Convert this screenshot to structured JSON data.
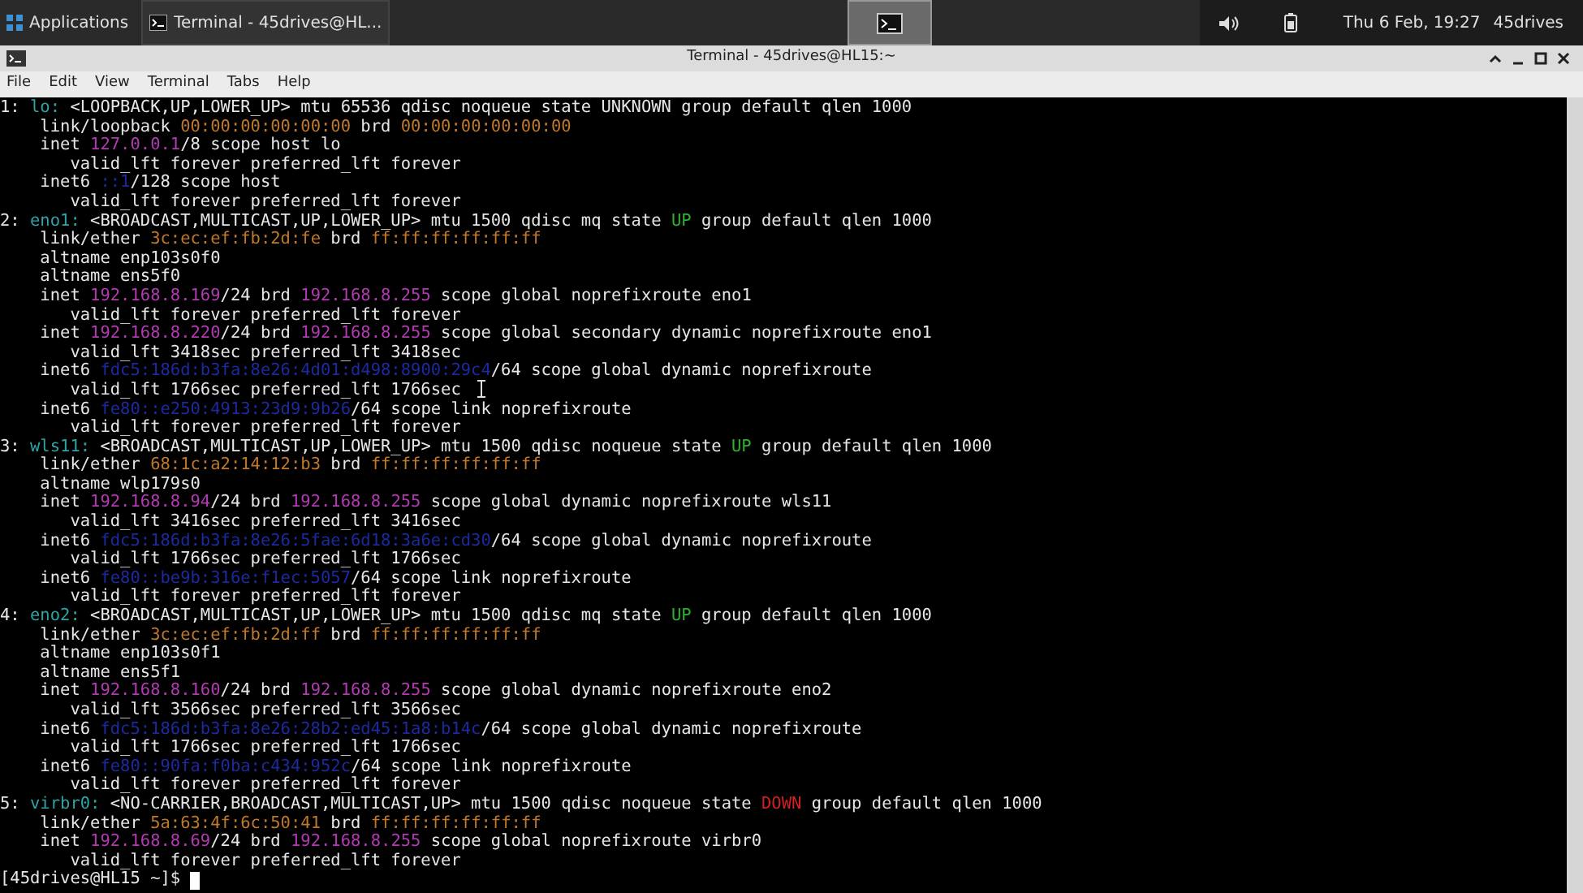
{
  "panel": {
    "apps_menu": "Applications",
    "tasks": [
      {
        "label": "Terminal - 45drives@HL...",
        "selected": false
      }
    ],
    "workspaces": [
      {
        "selected": true
      }
    ],
    "clock": "Thu 6 Feb, 19:27",
    "user": "45drives"
  },
  "window": {
    "title": "Terminal - 45drives@HL15:~"
  },
  "menu": [
    "File",
    "Edit",
    "View",
    "Terminal",
    "Tabs",
    "Help"
  ],
  "terminal": {
    "cursor_visible": true,
    "lines": [
      {
        "segments": [
          {
            "text": "1: ",
            "kind": "plain"
          },
          {
            "text": "lo:",
            "kind": "iface"
          },
          {
            "text": " <LOOPBACK,UP,LOWER_UP> mtu 65536 qdisc noqueue state UNKNOWN group default qlen 1000",
            "kind": "plain"
          }
        ]
      },
      {
        "segments": [
          {
            "text": "    link/loopback ",
            "kind": "plain"
          },
          {
            "text": "00:00:00:00:00:00",
            "kind": "mac"
          },
          {
            "text": " brd ",
            "kind": "plain"
          },
          {
            "text": "00:00:00:00:00:00",
            "kind": "mac"
          }
        ]
      },
      {
        "segments": [
          {
            "text": "    inet ",
            "kind": "plain"
          },
          {
            "text": "127.0.0.1",
            "kind": "ipv4"
          },
          {
            "text": "/8 scope host lo",
            "kind": "plain"
          }
        ]
      },
      {
        "segments": [
          {
            "text": "       valid_lft forever preferred_lft forever",
            "kind": "plain"
          }
        ]
      },
      {
        "segments": [
          {
            "text": "    inet6 ",
            "kind": "plain"
          },
          {
            "text": "::1",
            "kind": "ipv6"
          },
          {
            "text": "/128 scope host",
            "kind": "plain"
          }
        ]
      },
      {
        "segments": [
          {
            "text": "       valid_lft forever preferred_lft forever",
            "kind": "plain"
          }
        ]
      },
      {
        "segments": [
          {
            "text": "2: ",
            "kind": "plain"
          },
          {
            "text": "eno1:",
            "kind": "iface"
          },
          {
            "text": " <BROADCAST,MULTICAST,UP,LOWER_UP> mtu 1500 qdisc mq state ",
            "kind": "plain"
          },
          {
            "text": "UP",
            "kind": "up"
          },
          {
            "text": " group default qlen 1000",
            "kind": "plain"
          }
        ]
      },
      {
        "segments": [
          {
            "text": "    link/ether ",
            "kind": "plain"
          },
          {
            "text": "3c:ec:ef:fb:2d:fe",
            "kind": "mac"
          },
          {
            "text": " brd ",
            "kind": "plain"
          },
          {
            "text": "ff:ff:ff:ff:ff:ff",
            "kind": "mac"
          }
        ]
      },
      {
        "segments": [
          {
            "text": "    altname enp103s0f0",
            "kind": "plain"
          }
        ]
      },
      {
        "segments": [
          {
            "text": "    altname ens5f0",
            "kind": "plain"
          }
        ]
      },
      {
        "segments": [
          {
            "text": "    inet ",
            "kind": "plain"
          },
          {
            "text": "192.168.8.169",
            "kind": "ipv4"
          },
          {
            "text": "/24 brd ",
            "kind": "plain"
          },
          {
            "text": "192.168.8.255",
            "kind": "ipv4"
          },
          {
            "text": " scope global noprefixroute eno1",
            "kind": "plain"
          }
        ]
      },
      {
        "segments": [
          {
            "text": "       valid_lft forever preferred_lft forever",
            "kind": "plain"
          }
        ]
      },
      {
        "segments": [
          {
            "text": "    inet ",
            "kind": "plain"
          },
          {
            "text": "192.168.8.220",
            "kind": "ipv4"
          },
          {
            "text": "/24 brd ",
            "kind": "plain"
          },
          {
            "text": "192.168.8.255",
            "kind": "ipv4"
          },
          {
            "text": " scope global secondary dynamic noprefixroute eno1",
            "kind": "plain"
          }
        ]
      },
      {
        "segments": [
          {
            "text": "       valid_lft 3418sec preferred_lft 3418sec",
            "kind": "plain"
          }
        ]
      },
      {
        "segments": [
          {
            "text": "    inet6 ",
            "kind": "plain"
          },
          {
            "text": "fdc5:186d:b3fa:8e26:4d01:d498:8900:29c4",
            "kind": "ipv6"
          },
          {
            "text": "/64 scope global dynamic noprefixroute",
            "kind": "plain"
          }
        ]
      },
      {
        "segments": [
          {
            "text": "       valid_lft 1766sec preferred_lft 1766sec",
            "kind": "plain"
          }
        ]
      },
      {
        "segments": [
          {
            "text": "    inet6 ",
            "kind": "plain"
          },
          {
            "text": "fe80::e250:4913:23d9:9b26",
            "kind": "ipv6"
          },
          {
            "text": "/64 scope link noprefixroute",
            "kind": "plain"
          }
        ]
      },
      {
        "segments": [
          {
            "text": "       valid_lft forever preferred_lft forever",
            "kind": "plain"
          }
        ]
      },
      {
        "segments": [
          {
            "text": "3: ",
            "kind": "plain"
          },
          {
            "text": "wls11:",
            "kind": "iface"
          },
          {
            "text": " <BROADCAST,MULTICAST,UP,LOWER_UP> mtu 1500 qdisc noqueue state ",
            "kind": "plain"
          },
          {
            "text": "UP",
            "kind": "up"
          },
          {
            "text": " group default qlen 1000",
            "kind": "plain"
          }
        ]
      },
      {
        "segments": [
          {
            "text": "    link/ether ",
            "kind": "plain"
          },
          {
            "text": "68:1c:a2:14:12:b3",
            "kind": "mac"
          },
          {
            "text": " brd ",
            "kind": "plain"
          },
          {
            "text": "ff:ff:ff:ff:ff:ff",
            "kind": "mac"
          }
        ]
      },
      {
        "segments": [
          {
            "text": "    altname wlp179s0",
            "kind": "plain"
          }
        ]
      },
      {
        "segments": [
          {
            "text": "    inet ",
            "kind": "plain"
          },
          {
            "text": "192.168.8.94",
            "kind": "ipv4"
          },
          {
            "text": "/24 brd ",
            "kind": "plain"
          },
          {
            "text": "192.168.8.255",
            "kind": "ipv4"
          },
          {
            "text": " scope global dynamic noprefixroute wls11",
            "kind": "plain"
          }
        ]
      },
      {
        "segments": [
          {
            "text": "       valid_lft 3416sec preferred_lft 3416sec",
            "kind": "plain"
          }
        ]
      },
      {
        "segments": [
          {
            "text": "    inet6 ",
            "kind": "plain"
          },
          {
            "text": "fdc5:186d:b3fa:8e26:5fae:6d18:3a6e:cd30",
            "kind": "ipv6"
          },
          {
            "text": "/64 scope global dynamic noprefixroute",
            "kind": "plain"
          }
        ]
      },
      {
        "segments": [
          {
            "text": "       valid_lft 1766sec preferred_lft 1766sec",
            "kind": "plain"
          }
        ]
      },
      {
        "segments": [
          {
            "text": "    inet6 ",
            "kind": "plain"
          },
          {
            "text": "fe80::be9b:316e:f1ec:5057",
            "kind": "ipv6"
          },
          {
            "text": "/64 scope link noprefixroute",
            "kind": "plain"
          }
        ]
      },
      {
        "segments": [
          {
            "text": "       valid_lft forever preferred_lft forever",
            "kind": "plain"
          }
        ]
      },
      {
        "segments": [
          {
            "text": "4: ",
            "kind": "plain"
          },
          {
            "text": "eno2:",
            "kind": "iface"
          },
          {
            "text": " <BROADCAST,MULTICAST,UP,LOWER_UP> mtu 1500 qdisc mq state ",
            "kind": "plain"
          },
          {
            "text": "UP",
            "kind": "up"
          },
          {
            "text": " group default qlen 1000",
            "kind": "plain"
          }
        ]
      },
      {
        "segments": [
          {
            "text": "    link/ether ",
            "kind": "plain"
          },
          {
            "text": "3c:ec:ef:fb:2d:ff",
            "kind": "mac"
          },
          {
            "text": " brd ",
            "kind": "plain"
          },
          {
            "text": "ff:ff:ff:ff:ff:ff",
            "kind": "mac"
          }
        ]
      },
      {
        "segments": [
          {
            "text": "    altname enp103s0f1",
            "kind": "plain"
          }
        ]
      },
      {
        "segments": [
          {
            "text": "    altname ens5f1",
            "kind": "plain"
          }
        ]
      },
      {
        "segments": [
          {
            "text": "    inet ",
            "kind": "plain"
          },
          {
            "text": "192.168.8.160",
            "kind": "ipv4"
          },
          {
            "text": "/24 brd ",
            "kind": "plain"
          },
          {
            "text": "192.168.8.255",
            "kind": "ipv4"
          },
          {
            "text": " scope global dynamic noprefixroute eno2",
            "kind": "plain"
          }
        ]
      },
      {
        "segments": [
          {
            "text": "       valid_lft 3566sec preferred_lft 3566sec",
            "kind": "plain"
          }
        ]
      },
      {
        "segments": [
          {
            "text": "    inet6 ",
            "kind": "plain"
          },
          {
            "text": "fdc5:186d:b3fa:8e26:28b2:ed45:1a8:b14c",
            "kind": "ipv6"
          },
          {
            "text": "/64 scope global dynamic noprefixroute",
            "kind": "plain"
          }
        ]
      },
      {
        "segments": [
          {
            "text": "       valid_lft 1766sec preferred_lft 1766sec",
            "kind": "plain"
          }
        ]
      },
      {
        "segments": [
          {
            "text": "    inet6 ",
            "kind": "plain"
          },
          {
            "text": "fe80::90fa:f0ba:c434:952c",
            "kind": "ipv6"
          },
          {
            "text": "/64 scope link noprefixroute",
            "kind": "plain"
          }
        ]
      },
      {
        "segments": [
          {
            "text": "       valid_lft forever preferred_lft forever",
            "kind": "plain"
          }
        ]
      },
      {
        "segments": [
          {
            "text": "5: ",
            "kind": "plain"
          },
          {
            "text": "virbr0:",
            "kind": "iface"
          },
          {
            "text": " <NO-CARRIER,BROADCAST,MULTICAST,UP> mtu 1500 qdisc noqueue state ",
            "kind": "plain"
          },
          {
            "text": "DOWN",
            "kind": "down"
          },
          {
            "text": " group default qlen 1000",
            "kind": "plain"
          }
        ]
      },
      {
        "segments": [
          {
            "text": "    link/ether ",
            "kind": "plain"
          },
          {
            "text": "5a:63:4f:6c:50:41",
            "kind": "mac"
          },
          {
            "text": " brd ",
            "kind": "plain"
          },
          {
            "text": "ff:ff:ff:ff:ff:ff",
            "kind": "mac"
          }
        ]
      },
      {
        "segments": [
          {
            "text": "    inet ",
            "kind": "plain"
          },
          {
            "text": "192.168.8.69",
            "kind": "ipv4"
          },
          {
            "text": "/24 brd ",
            "kind": "plain"
          },
          {
            "text": "192.168.8.255",
            "kind": "ipv4"
          },
          {
            "text": " scope global noprefixroute virbr0",
            "kind": "plain"
          }
        ]
      },
      {
        "segments": [
          {
            "text": "       valid_lft forever preferred_lft forever",
            "kind": "plain"
          }
        ]
      },
      {
        "segments": [
          {
            "text": "[45drives@HL15 ~]$ ",
            "kind": "plain"
          }
        ]
      }
    ]
  }
}
